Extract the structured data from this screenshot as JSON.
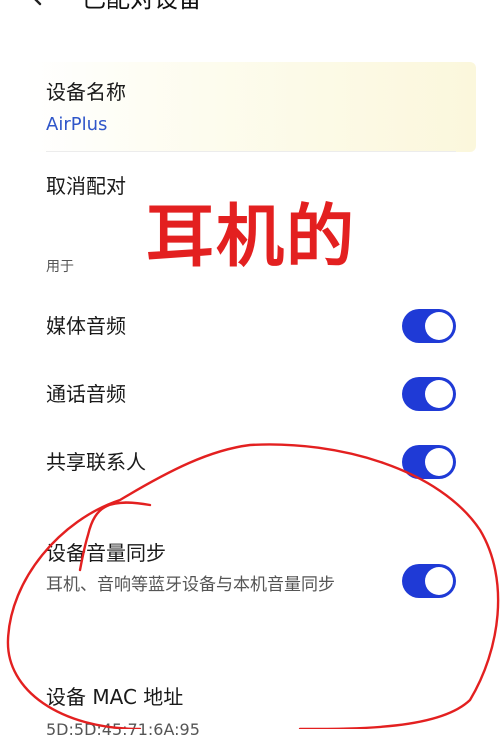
{
  "header": {
    "title": "已配对设备",
    "back_icon": "chevron-left-icon"
  },
  "device_name": {
    "label": "设备名称",
    "value": "AirPlus"
  },
  "unpair": {
    "label": "取消配对"
  },
  "used_for": {
    "section_label": "用于",
    "items": [
      {
        "label": "媒体音频",
        "enabled": true
      },
      {
        "label": "通话音频",
        "enabled": true
      },
      {
        "label": "共享联系人",
        "enabled": true
      }
    ]
  },
  "volume_sync": {
    "label": "设备音量同步",
    "description": "耳机、音响等蓝牙设备与本机音量同步",
    "enabled": true
  },
  "mac": {
    "label": "设备 MAC 地址",
    "value": "5D:5D:45:71:6A:95"
  },
  "annotation": {
    "text": "耳机的",
    "color": "#e32020"
  },
  "colors": {
    "accent": "#1f3ad6",
    "link": "#2f56c9"
  }
}
